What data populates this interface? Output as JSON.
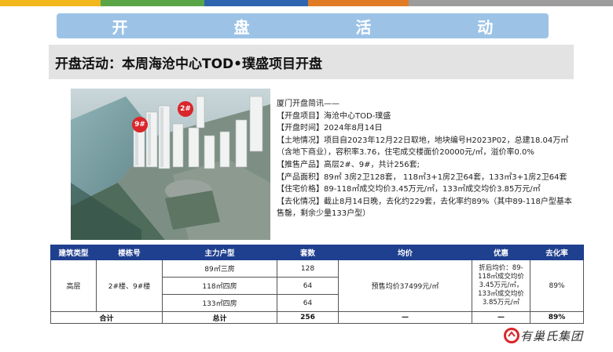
{
  "colors": {
    "top_strip": [
      "#f2b71b",
      "#5aa548",
      "#2f64b0",
      "#e27b25",
      "#9c9c9c"
    ],
    "banner_bg": "#9cc3e6",
    "table_header_bg": "#1f3f8f",
    "brand_red": "#d9262b"
  },
  "banner": {
    "title": "开 盘 活 动"
  },
  "subtitle": "开盘活动：本周海沧中心TOD•璞盛项目开盘",
  "photo": {
    "tags": [
      "2#",
      "9#"
    ]
  },
  "info": {
    "lines": [
      "厦门开盘简讯——",
      "【开盘项目】海沧中心TOD-璞盛",
      "【开盘时间】2024年8月14日",
      "【土地情况】项目自2023年12月22日取地，地块编号H2023P02，总建18.04万㎡（含地下商业），容积率3.76，住宅成交楼面价20000元/㎡，溢价率0.0%",
      "【推售产品】高层2#、9#，共计256套;",
      "【产品面积】89㎡ 3房2卫128套， 118㎡3+1房2卫64套，133㎡3+1房2卫64套",
      "【住宅价格】89-118㎡成交均价3.45万元/㎡，133㎡成交均价3.85万元/㎡",
      "【去化情况】截止8月14日晚，去化约229套，去化率约89%（其中89-118户型基本售罄，剩余少量133户型）"
    ]
  },
  "table": {
    "headers": [
      "建筑类型",
      "楼栋号",
      "主力户型",
      "套数",
      "均价",
      "优惠",
      "去化率"
    ],
    "building_type": "高层",
    "buildings": "2#楼、9#楼",
    "rows": [
      {
        "unit": "89㎡三房",
        "count": "128"
      },
      {
        "unit": "118㎡四房",
        "count": "64"
      },
      {
        "unit": "133㎡四房",
        "count": "64"
      }
    ],
    "avg_price": "预售均价37499元/㎡",
    "discount": "折后均价：89-118㎡成交均价3.45万元/㎡，133㎡成交均价3.85万元/㎡",
    "sell_rate": "89%",
    "total": {
      "label": "合计",
      "unit": "总计",
      "count": "256",
      "avg_price": "—",
      "discount": "—",
      "sell_rate": "89%"
    }
  },
  "brand": {
    "logo_text": "有巢氏集团"
  }
}
